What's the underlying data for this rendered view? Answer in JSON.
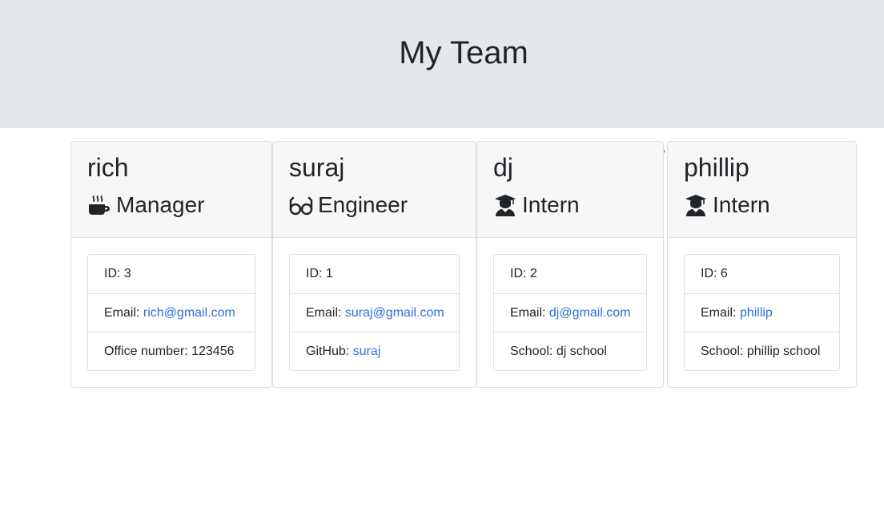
{
  "header": {
    "title": "My Team"
  },
  "employees": [
    {
      "name": "rich",
      "role": "Manager",
      "icon": "coffee-mug-icon",
      "id_label": "ID: ",
      "id": "3",
      "email_label": "Email: ",
      "email": "rich@gmail.com",
      "extra_label": "Office number: ",
      "extra_value": "123456"
    },
    {
      "name": "suraj",
      "role": "Engineer",
      "icon": "glasses-icon",
      "id_label": "ID: ",
      "id": "1",
      "email_label": "Email: ",
      "email": "suraj@gmail.com",
      "extra_label": "GitHub: ",
      "extra_value": "suraj"
    },
    {
      "name": "dj",
      "role": "Intern",
      "icon": "graduate-icon",
      "id_label": "ID: ",
      "id": "2",
      "email_label": "Email: ",
      "email": "dj@gmail.com",
      "extra_label": "School: ",
      "extra_value": "dj school"
    },
    {
      "name": "phillip",
      "role": "Intern",
      "icon": "graduate-icon",
      "id_label": "ID: ",
      "id": "6",
      "email_label": "Email: ",
      "email": "phillip",
      "extra_label": "School: ",
      "extra_value": "phillip school"
    }
  ],
  "stray_mark": "’",
  "colors": {
    "jumbotron": "#e5e8eb",
    "link": "#2f6fdc",
    "card_header": "#f7f7f7"
  }
}
